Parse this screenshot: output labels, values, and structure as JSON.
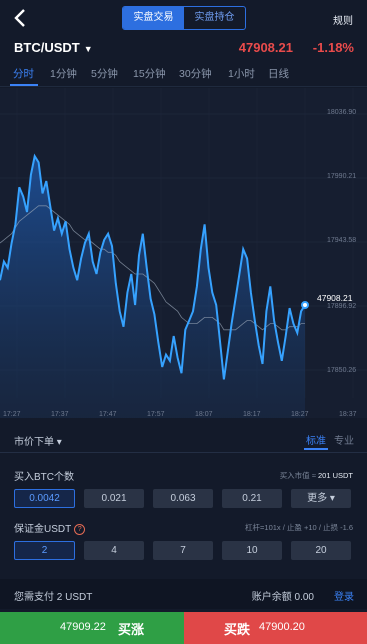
{
  "tabs": [
    "实盘交易",
    "实盘持仓"
  ],
  "rules_label": "规则",
  "pair": "BTC/USDT",
  "price": "47908.21",
  "change": "-1.18%",
  "timeframes": [
    "分时",
    "1分钟",
    "5分钟",
    "15分钟",
    "30分钟",
    "1小时",
    "日线"
  ],
  "chart_data": {
    "type": "area",
    "y_ticks": [
      "18036.90",
      "17990.21",
      "17943.58",
      "17896.92",
      "17850.26"
    ],
    "x_ticks": [
      "17:27",
      "17:37",
      "17:47",
      "17:57",
      "18:07",
      "18:17",
      "18:27",
      "18:37"
    ],
    "current_label": "47908.21",
    "values": [
      0.62,
      0.56,
      0.58,
      0.5,
      0.44,
      0.32,
      0.35,
      0.4,
      0.28,
      0.22,
      0.24,
      0.34,
      0.3,
      0.38,
      0.46,
      0.42,
      0.47,
      0.43,
      0.52,
      0.58,
      0.62,
      0.55,
      0.5,
      0.47,
      0.56,
      0.6,
      0.53,
      0.49,
      0.47,
      0.51,
      0.63,
      0.72,
      0.77,
      0.66,
      0.6,
      0.7,
      0.54,
      0.47,
      0.58,
      0.68,
      0.73,
      0.82,
      0.9,
      0.86,
      0.88,
      0.8,
      0.87,
      0.92,
      0.78,
      0.75,
      0.72,
      0.64,
      0.52,
      0.44,
      0.58,
      0.66,
      0.7,
      0.82,
      0.94,
      0.85,
      0.76,
      0.68,
      0.6,
      0.52,
      0.55,
      0.66,
      0.75,
      0.83,
      0.89,
      0.72,
      0.64,
      0.75,
      0.82,
      0.88,
      0.8,
      0.71,
      0.76,
      0.79,
      0.72,
      0.7
    ],
    "ma": [
      0.5,
      0.49,
      0.48,
      0.47,
      0.45,
      0.43,
      0.42,
      0.41,
      0.4,
      0.39,
      0.38,
      0.38,
      0.38,
      0.39,
      0.4,
      0.41,
      0.42,
      0.43,
      0.44,
      0.46,
      0.47,
      0.48,
      0.49,
      0.49,
      0.5,
      0.51,
      0.52,
      0.52,
      0.53,
      0.53,
      0.54,
      0.56,
      0.57,
      0.58,
      0.59,
      0.6,
      0.6,
      0.6,
      0.61,
      0.62,
      0.63,
      0.65,
      0.67,
      0.69,
      0.7,
      0.71,
      0.72,
      0.74,
      0.75,
      0.76,
      0.76,
      0.76,
      0.75,
      0.74,
      0.74,
      0.74,
      0.75,
      0.76,
      0.78,
      0.78,
      0.78,
      0.78,
      0.77,
      0.76,
      0.75,
      0.75,
      0.76,
      0.77,
      0.78,
      0.77,
      0.76,
      0.76,
      0.77,
      0.78,
      0.78,
      0.77,
      0.77,
      0.77,
      0.76,
      0.76
    ]
  },
  "order_type": "市价下单 ▾",
  "modes": [
    "标准",
    "专业"
  ],
  "qty_label": "买入BTC个数",
  "qty_hint_prefix": "买入市值 ≈",
  "qty_hint_value": "201 USDT",
  "qty_options": [
    "0.0042",
    "0.021",
    "0.063",
    "0.21",
    "更多 ▾"
  ],
  "margin_label": "保证金USDT",
  "margin_help": "?",
  "margin_hint": "杠杆=101x / 止盈 +10 / 止损 -1.6",
  "margin_options": [
    "2",
    "4",
    "7",
    "10",
    "20"
  ],
  "pay_text": "您需支付 2 USDT",
  "balance_text": "账户余额 0.00",
  "login": "登录",
  "buy_price": "47909.22",
  "buy_label": "买涨",
  "sell_label": "买跌",
  "sell_price": "47900.20",
  "colors": {
    "accent": "#3b82f6",
    "up": "#2f9f45",
    "down": "#e04848"
  }
}
